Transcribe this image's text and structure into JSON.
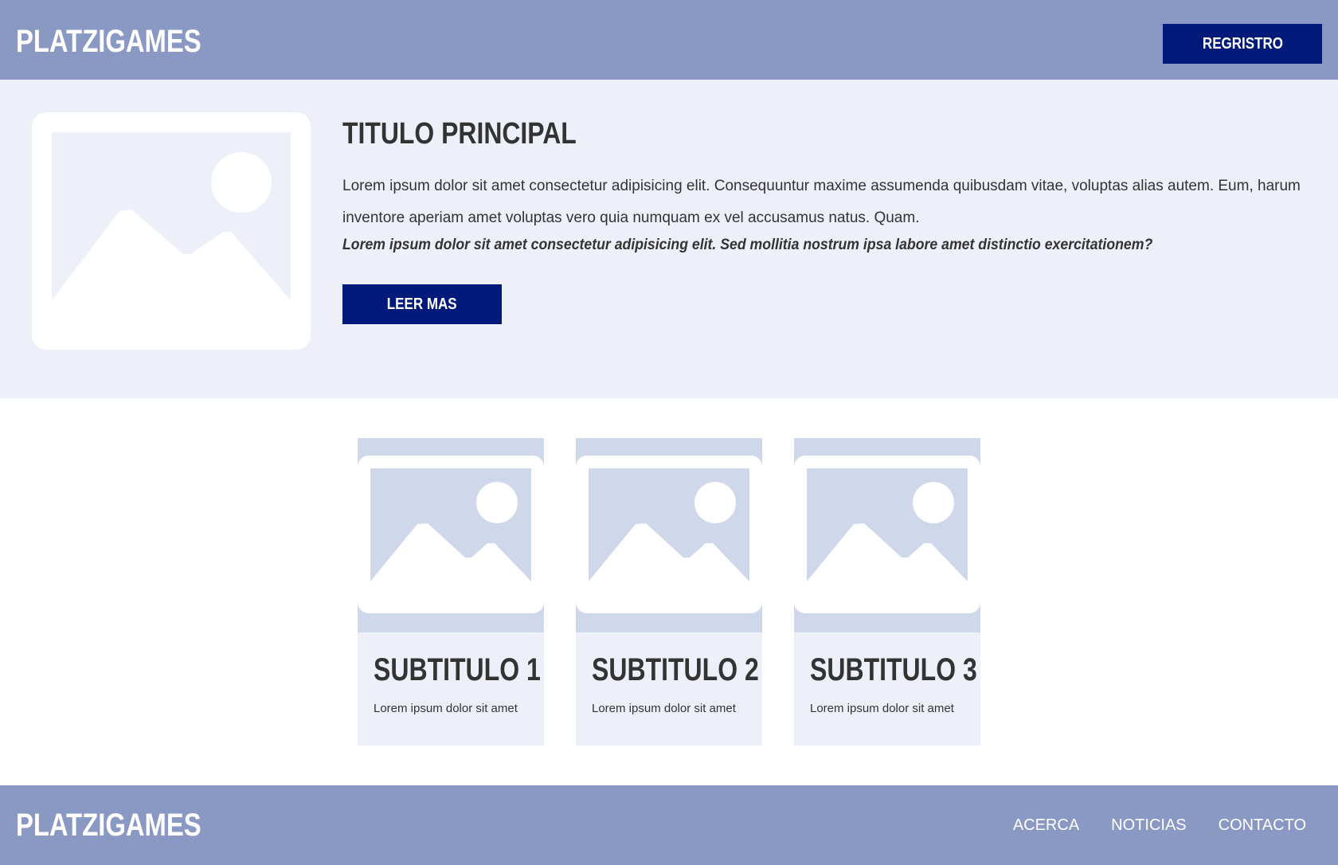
{
  "colors": {
    "header_bg": "#8a99c3",
    "hero_bg": "#edf0f8",
    "button_bg": "#001a7a",
    "card_media_bg": "#cfd7ea",
    "text": "#333333"
  },
  "header": {
    "logo": "PLATZIGAMES",
    "register_label": "REGRISTRO"
  },
  "hero": {
    "image_icon": "image-placeholder-icon",
    "title": "TITULO PRINCIPAL",
    "paragraph": "Lorem ipsum dolor sit amet consectetur adipisicing elit. Consequuntur maxime assumenda quibusdam vitae, voluptas alias autem. Eum, harum inventore aperiam amet voluptas vero quia numquam ex vel accusamus natus. Quam.",
    "emphasis": "Lorem ipsum dolor sit amet consectetur adipisicing elit. Sed mollitia nostrum ipsa labore amet distinctio exercitationem?",
    "button_label": "LEER MAS"
  },
  "cards": [
    {
      "title": "SUBTITULO 1",
      "text": "Lorem ipsum dolor sit amet",
      "image_icon": "image-placeholder-icon"
    },
    {
      "title": "SUBTITULO 2",
      "text": "Lorem ipsum dolor sit amet",
      "image_icon": "image-placeholder-icon"
    },
    {
      "title": "SUBTITULO 3",
      "text": "Lorem ipsum dolor sit amet",
      "image_icon": "image-placeholder-icon"
    }
  ],
  "footer": {
    "logo": "PLATZIGAMES",
    "nav": [
      "ACERCA",
      "NOTICIAS",
      "CONTACTO"
    ]
  }
}
